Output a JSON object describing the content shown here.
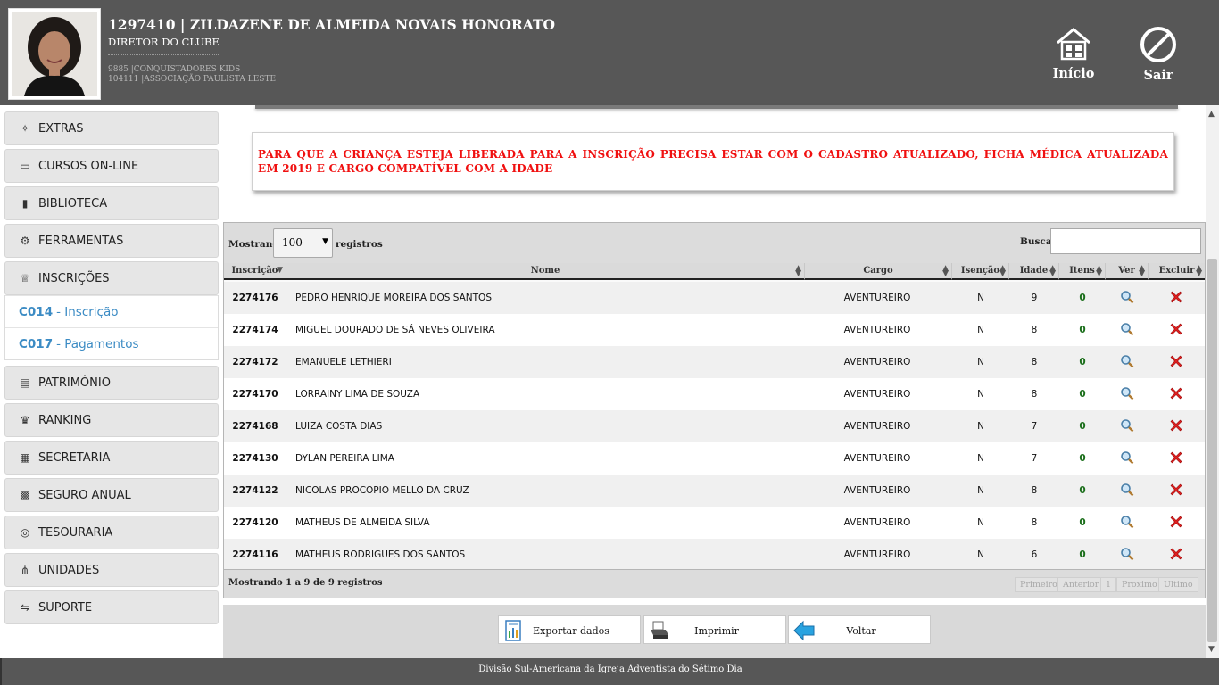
{
  "header": {
    "user_title": "1297410 | ZILDAZENE DE ALMEIDA NOVAIS HONORATO",
    "user_role": "DIRETOR DO CLUBE",
    "club": "9885 |CONQUISTADORES KIDS",
    "association": "104111 |ASSOCIAÇÃO PAULISTA LESTE",
    "home_label": "Início",
    "exit_label": "Sair"
  },
  "sidebar": {
    "items": [
      {
        "label": "EXTRAS",
        "icon": "wand-icon"
      },
      {
        "label": "CURSOS ON-LINE",
        "icon": "laptop-icon"
      },
      {
        "label": "BIBLIOTECA",
        "icon": "book-icon"
      },
      {
        "label": "FERRAMENTAS",
        "icon": "gears-icon"
      },
      {
        "label": "INSCRIÇÕES",
        "icon": "basket-icon"
      },
      {
        "label": "PATRIMÔNIO",
        "icon": "money-icon"
      },
      {
        "label": "RANKING",
        "icon": "trophy-icon"
      },
      {
        "label": "SECRETARIA",
        "icon": "clipboard-icon"
      },
      {
        "label": "SEGURO ANUAL",
        "icon": "briefcase-icon"
      },
      {
        "label": "TESOURARIA",
        "icon": "coins-icon"
      },
      {
        "label": "UNIDADES",
        "icon": "sitemap-icon"
      },
      {
        "label": "SUPORTE",
        "icon": "handshake-icon"
      }
    ],
    "submenu": [
      {
        "code": "C014",
        "label": "- Inscrição"
      },
      {
        "code": "C017",
        "label": "- Pagamentos"
      }
    ]
  },
  "notice": "PARA QUE A CRIANÇA ESTEJA LIBERADA PARA A INSCRIÇÃO PRECISA ESTAR COM O CADASTRO ATUALIZADO, FICHA MÉDICA ATUALIZADA EM 2019 E CARGO COMPATÍVEL COM A IDADE",
  "table": {
    "showing_label": "Mostrando",
    "page_size": "100",
    "records_label": "registros",
    "search_label": "Buscar:",
    "search_value": "",
    "columns": [
      "Inscrição",
      "Nome",
      "Cargo",
      "Isenção",
      "Idade",
      "Itens",
      "Ver",
      "Excluir"
    ],
    "rows": [
      {
        "id": "2274176",
        "nome": "PEDRO HENRIQUE MOREIRA DOS SANTOS",
        "cargo": "AVENTUREIRO",
        "isencao": "N",
        "idade": "9",
        "itens": "0"
      },
      {
        "id": "2274174",
        "nome": "MIGUEL DOURADO DE SÁ NEVES OLIVEIRA",
        "cargo": "AVENTUREIRO",
        "isencao": "N",
        "idade": "8",
        "itens": "0"
      },
      {
        "id": "2274172",
        "nome": "EMANUELE LETHIERI",
        "cargo": "AVENTUREIRO",
        "isencao": "N",
        "idade": "8",
        "itens": "0"
      },
      {
        "id": "2274170",
        "nome": "LORRAINY LIMA DE SOUZA",
        "cargo": "AVENTUREIRO",
        "isencao": "N",
        "idade": "8",
        "itens": "0"
      },
      {
        "id": "2274168",
        "nome": "LUIZA COSTA DIAS",
        "cargo": "AVENTUREIRO",
        "isencao": "N",
        "idade": "7",
        "itens": "0"
      },
      {
        "id": "2274130",
        "nome": "DYLAN PEREIRA LIMA",
        "cargo": "AVENTUREIRO",
        "isencao": "N",
        "idade": "7",
        "itens": "0"
      },
      {
        "id": "2274122",
        "nome": "NICOLAS PROCOPIO MELLO DA CRUZ",
        "cargo": "AVENTUREIRO",
        "isencao": "N",
        "idade": "8",
        "itens": "0"
      },
      {
        "id": "2274120",
        "nome": "MATHEUS DE ALMEIDA SILVA",
        "cargo": "AVENTUREIRO",
        "isencao": "N",
        "idade": "8",
        "itens": "0"
      },
      {
        "id": "2274116",
        "nome": "MATHEUS RODRIGUES DOS SANTOS",
        "cargo": "AVENTUREIRO",
        "isencao": "N",
        "idade": "6",
        "itens": "0"
      }
    ],
    "info": "Mostrando 1 a 9 de 9 registros",
    "pagination": {
      "first": "Primeiro",
      "prev": "Anterior",
      "page": "1",
      "next": "Proximo",
      "last": "Ultimo"
    }
  },
  "actions": {
    "export": "Exportar dados",
    "print": "Imprimir",
    "back": "Voltar"
  },
  "footer": "Divisão Sul-Americana da Igreja Adventista do Sétimo Dia",
  "colors": {
    "header_bg": "#575757",
    "notice_text": "#f01010",
    "link_blue": "#3b8bc4",
    "delete_red": "#e02020"
  }
}
